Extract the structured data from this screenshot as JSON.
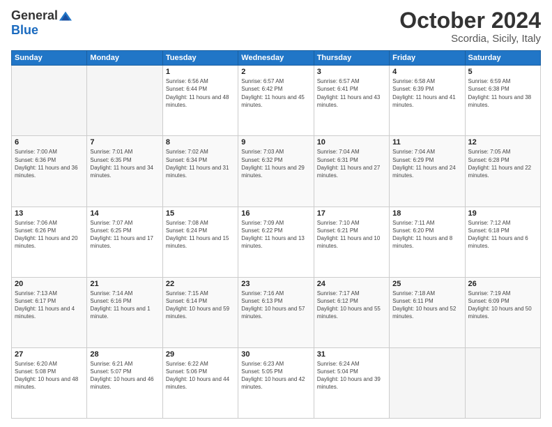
{
  "logo": {
    "general": "General",
    "blue": "Blue"
  },
  "title": "October 2024",
  "location": "Scordia, Sicily, Italy",
  "days_of_week": [
    "Sunday",
    "Monday",
    "Tuesday",
    "Wednesday",
    "Thursday",
    "Friday",
    "Saturday"
  ],
  "weeks": [
    [
      {
        "num": "",
        "sunrise": "",
        "sunset": "",
        "daylight": ""
      },
      {
        "num": "",
        "sunrise": "",
        "sunset": "",
        "daylight": ""
      },
      {
        "num": "1",
        "sunrise": "Sunrise: 6:56 AM",
        "sunset": "Sunset: 6:44 PM",
        "daylight": "Daylight: 11 hours and 48 minutes."
      },
      {
        "num": "2",
        "sunrise": "Sunrise: 6:57 AM",
        "sunset": "Sunset: 6:42 PM",
        "daylight": "Daylight: 11 hours and 45 minutes."
      },
      {
        "num": "3",
        "sunrise": "Sunrise: 6:57 AM",
        "sunset": "Sunset: 6:41 PM",
        "daylight": "Daylight: 11 hours and 43 minutes."
      },
      {
        "num": "4",
        "sunrise": "Sunrise: 6:58 AM",
        "sunset": "Sunset: 6:39 PM",
        "daylight": "Daylight: 11 hours and 41 minutes."
      },
      {
        "num": "5",
        "sunrise": "Sunrise: 6:59 AM",
        "sunset": "Sunset: 6:38 PM",
        "daylight": "Daylight: 11 hours and 38 minutes."
      }
    ],
    [
      {
        "num": "6",
        "sunrise": "Sunrise: 7:00 AM",
        "sunset": "Sunset: 6:36 PM",
        "daylight": "Daylight: 11 hours and 36 minutes."
      },
      {
        "num": "7",
        "sunrise": "Sunrise: 7:01 AM",
        "sunset": "Sunset: 6:35 PM",
        "daylight": "Daylight: 11 hours and 34 minutes."
      },
      {
        "num": "8",
        "sunrise": "Sunrise: 7:02 AM",
        "sunset": "Sunset: 6:34 PM",
        "daylight": "Daylight: 11 hours and 31 minutes."
      },
      {
        "num": "9",
        "sunrise": "Sunrise: 7:03 AM",
        "sunset": "Sunset: 6:32 PM",
        "daylight": "Daylight: 11 hours and 29 minutes."
      },
      {
        "num": "10",
        "sunrise": "Sunrise: 7:04 AM",
        "sunset": "Sunset: 6:31 PM",
        "daylight": "Daylight: 11 hours and 27 minutes."
      },
      {
        "num": "11",
        "sunrise": "Sunrise: 7:04 AM",
        "sunset": "Sunset: 6:29 PM",
        "daylight": "Daylight: 11 hours and 24 minutes."
      },
      {
        "num": "12",
        "sunrise": "Sunrise: 7:05 AM",
        "sunset": "Sunset: 6:28 PM",
        "daylight": "Daylight: 11 hours and 22 minutes."
      }
    ],
    [
      {
        "num": "13",
        "sunrise": "Sunrise: 7:06 AM",
        "sunset": "Sunset: 6:26 PM",
        "daylight": "Daylight: 11 hours and 20 minutes."
      },
      {
        "num": "14",
        "sunrise": "Sunrise: 7:07 AM",
        "sunset": "Sunset: 6:25 PM",
        "daylight": "Daylight: 11 hours and 17 minutes."
      },
      {
        "num": "15",
        "sunrise": "Sunrise: 7:08 AM",
        "sunset": "Sunset: 6:24 PM",
        "daylight": "Daylight: 11 hours and 15 minutes."
      },
      {
        "num": "16",
        "sunrise": "Sunrise: 7:09 AM",
        "sunset": "Sunset: 6:22 PM",
        "daylight": "Daylight: 11 hours and 13 minutes."
      },
      {
        "num": "17",
        "sunrise": "Sunrise: 7:10 AM",
        "sunset": "Sunset: 6:21 PM",
        "daylight": "Daylight: 11 hours and 10 minutes."
      },
      {
        "num": "18",
        "sunrise": "Sunrise: 7:11 AM",
        "sunset": "Sunset: 6:20 PM",
        "daylight": "Daylight: 11 hours and 8 minutes."
      },
      {
        "num": "19",
        "sunrise": "Sunrise: 7:12 AM",
        "sunset": "Sunset: 6:18 PM",
        "daylight": "Daylight: 11 hours and 6 minutes."
      }
    ],
    [
      {
        "num": "20",
        "sunrise": "Sunrise: 7:13 AM",
        "sunset": "Sunset: 6:17 PM",
        "daylight": "Daylight: 11 hours and 4 minutes."
      },
      {
        "num": "21",
        "sunrise": "Sunrise: 7:14 AM",
        "sunset": "Sunset: 6:16 PM",
        "daylight": "Daylight: 11 hours and 1 minute."
      },
      {
        "num": "22",
        "sunrise": "Sunrise: 7:15 AM",
        "sunset": "Sunset: 6:14 PM",
        "daylight": "Daylight: 10 hours and 59 minutes."
      },
      {
        "num": "23",
        "sunrise": "Sunrise: 7:16 AM",
        "sunset": "Sunset: 6:13 PM",
        "daylight": "Daylight: 10 hours and 57 minutes."
      },
      {
        "num": "24",
        "sunrise": "Sunrise: 7:17 AM",
        "sunset": "Sunset: 6:12 PM",
        "daylight": "Daylight: 10 hours and 55 minutes."
      },
      {
        "num": "25",
        "sunrise": "Sunrise: 7:18 AM",
        "sunset": "Sunset: 6:11 PM",
        "daylight": "Daylight: 10 hours and 52 minutes."
      },
      {
        "num": "26",
        "sunrise": "Sunrise: 7:19 AM",
        "sunset": "Sunset: 6:09 PM",
        "daylight": "Daylight: 10 hours and 50 minutes."
      }
    ],
    [
      {
        "num": "27",
        "sunrise": "Sunrise: 6:20 AM",
        "sunset": "Sunset: 5:08 PM",
        "daylight": "Daylight: 10 hours and 48 minutes."
      },
      {
        "num": "28",
        "sunrise": "Sunrise: 6:21 AM",
        "sunset": "Sunset: 5:07 PM",
        "daylight": "Daylight: 10 hours and 46 minutes."
      },
      {
        "num": "29",
        "sunrise": "Sunrise: 6:22 AM",
        "sunset": "Sunset: 5:06 PM",
        "daylight": "Daylight: 10 hours and 44 minutes."
      },
      {
        "num": "30",
        "sunrise": "Sunrise: 6:23 AM",
        "sunset": "Sunset: 5:05 PM",
        "daylight": "Daylight: 10 hours and 42 minutes."
      },
      {
        "num": "31",
        "sunrise": "Sunrise: 6:24 AM",
        "sunset": "Sunset: 5:04 PM",
        "daylight": "Daylight: 10 hours and 39 minutes."
      },
      {
        "num": "",
        "sunrise": "",
        "sunset": "",
        "daylight": ""
      },
      {
        "num": "",
        "sunrise": "",
        "sunset": "",
        "daylight": ""
      }
    ]
  ]
}
